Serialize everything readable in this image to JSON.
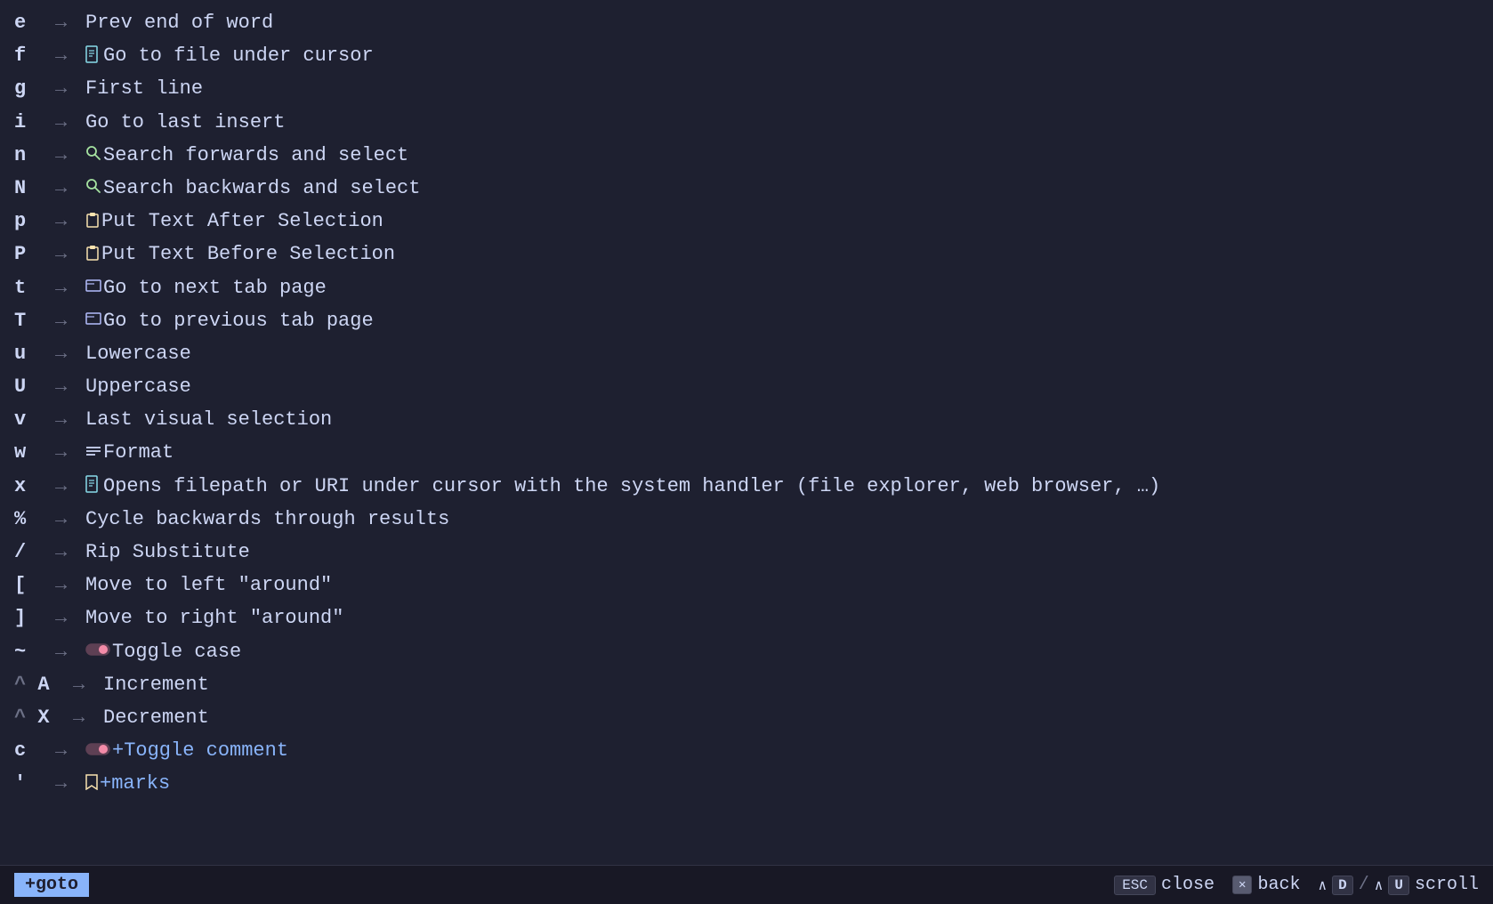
{
  "rows": [
    {
      "key": "e",
      "icon": null,
      "icon_type": null,
      "description": "Prev end of word",
      "desc_class": "description"
    },
    {
      "key": "f",
      "icon": "📄",
      "icon_type": "file",
      "description": "Go to file under cursor",
      "desc_class": "description"
    },
    {
      "key": "g",
      "icon": null,
      "icon_type": null,
      "description": "First line",
      "desc_class": "description"
    },
    {
      "key": "i",
      "icon": null,
      "icon_type": null,
      "description": "Go to last insert",
      "desc_class": "description"
    },
    {
      "key": "n",
      "icon": "🔍",
      "icon_type": "search",
      "description": "Search forwards and select",
      "desc_class": "description"
    },
    {
      "key": "N",
      "icon": "🔍",
      "icon_type": "search",
      "description": "Search backwards and select",
      "desc_class": "description"
    },
    {
      "key": "p",
      "icon": "📋",
      "icon_type": "clipboard",
      "description": "Put Text After Selection",
      "desc_class": "description"
    },
    {
      "key": "P",
      "icon": "📋",
      "icon_type": "clipboard",
      "description": "Put Text Before Selection",
      "desc_class": "description"
    },
    {
      "key": "t",
      "icon": "⬜",
      "icon_type": "tab",
      "description": "Go to next tab page",
      "desc_class": "description"
    },
    {
      "key": "T",
      "icon": "⬜",
      "icon_type": "tab",
      "description": "Go to previous tab page",
      "desc_class": "description"
    },
    {
      "key": "u",
      "icon": null,
      "icon_type": null,
      "description": "Lowercase",
      "desc_class": "description"
    },
    {
      "key": "U",
      "icon": null,
      "icon_type": null,
      "description": "Uppercase",
      "desc_class": "description"
    },
    {
      "key": "v",
      "icon": null,
      "icon_type": null,
      "description": "Last visual selection",
      "desc_class": "description"
    },
    {
      "key": "w",
      "icon": "≡",
      "icon_type": "format",
      "description": "Format",
      "desc_class": "description"
    },
    {
      "key": "x",
      "icon": "📄",
      "icon_type": "file",
      "description": "Opens filepath or URI under cursor with the system handler (file explorer, web browser, …)",
      "desc_class": "description"
    },
    {
      "key": "%",
      "icon": null,
      "icon_type": null,
      "description": "Cycle backwards through results",
      "desc_class": "description"
    },
    {
      "key": "/",
      "icon": null,
      "icon_type": null,
      "description": "Rip Substitute",
      "desc_class": "description"
    },
    {
      "key": "[",
      "icon": null,
      "icon_type": null,
      "description": "Move to left \"around\"",
      "desc_class": "description"
    },
    {
      "key": "]",
      "icon": null,
      "icon_type": null,
      "description": "Move to right \"around\"",
      "desc_class": "description"
    },
    {
      "key": "~",
      "icon": "🔘",
      "icon_type": "toggle",
      "description": "Toggle case",
      "desc_class": "description"
    },
    {
      "key": "^ A",
      "icon": null,
      "icon_type": null,
      "description": "Increment",
      "desc_class": "description"
    },
    {
      "key": "^ X",
      "icon": null,
      "icon_type": null,
      "description": "Decrement",
      "desc_class": "description"
    },
    {
      "key": "c",
      "icon": "🔘",
      "icon_type": "toggle",
      "description": "+Toggle comment",
      "desc_class": "description-blue"
    },
    {
      "key": "'",
      "icon": "🔖",
      "icon_type": "bookmark",
      "description": "+marks",
      "desc_class": "description-blue"
    }
  ],
  "status": {
    "left_label": "+goto",
    "esc_label": "ESC",
    "close_label": "close",
    "back_label": "back",
    "scroll_label": "scroll",
    "ctrl_d": "^ D",
    "ctrl_u": "^ U"
  }
}
